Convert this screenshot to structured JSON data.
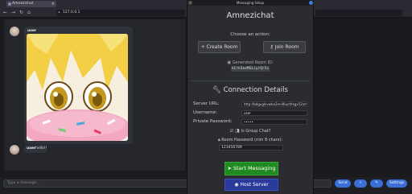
{
  "browser": {
    "tab_title": "Amnezichat",
    "tab_close": "×",
    "url": "127.0.0.1",
    "nav_back": "←",
    "nav_forward": "→",
    "nav_reload": "↻",
    "nav_home": "⌂"
  },
  "chat": {
    "messages": [
      {
        "user": "user",
        "text": ""
      },
      {
        "user": "user",
        "text": "hello!!"
      }
    ],
    "input_placeholder": "Type a message...",
    "buttons": {
      "send": "Send",
      "settings": "Settings"
    }
  },
  "modal": {
    "window_title": "Messaging Setup",
    "app_title": "Amnezichat",
    "choose_label": "Choose an action:",
    "create_room": "Create Room",
    "join_room": "Join Room",
    "generated_label": "Generated Room ID:",
    "generated_id": "kCrk3oeMSLiyrQr5s",
    "connection_heading": "Connection Details",
    "server_url_label": "Server URL:",
    "server_url_value": "http://bdguglvvwbx2en46ucthkgx52zm",
    "username_label": "Username:",
    "username_value": "user",
    "private_password_label": "Private Password:",
    "private_password_value": "•••••",
    "group_chat_label": "Is Group Chat?",
    "group_chat_checked": true,
    "room_password_label": "Room Password (min 8 chars):",
    "room_password_value": "123456789",
    "start_button": "Start Messaging",
    "host_button": "Host Server"
  }
}
